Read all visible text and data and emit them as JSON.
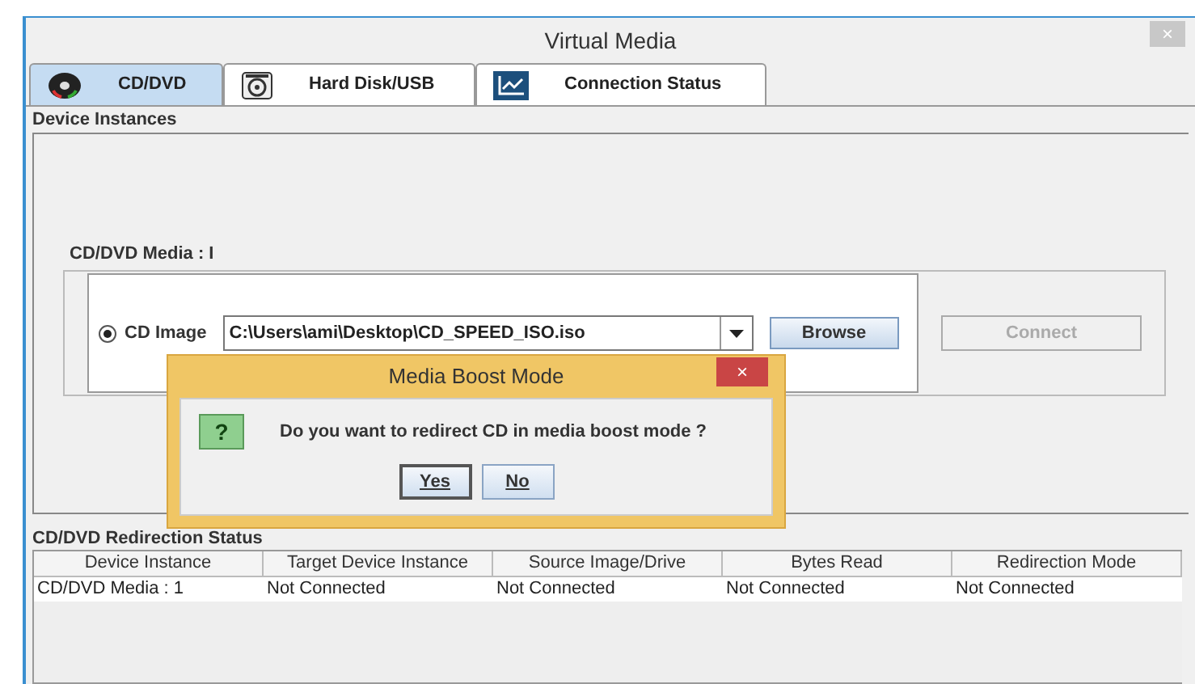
{
  "window": {
    "title": "Virtual Media",
    "close": "×"
  },
  "tabs": [
    {
      "label": "CD/DVD",
      "selected": true,
      "kind": "disc"
    },
    {
      "label": "Hard Disk/USB",
      "selected": false,
      "kind": "drive"
    },
    {
      "label": "Connection Status",
      "selected": false,
      "kind": "chart"
    }
  ],
  "device_instances": {
    "title": "Device Instances",
    "media_title": "CD/DVD Media : I",
    "option": {
      "label": "CD Image",
      "selected": true
    },
    "path": "C:\\Users\\ami\\Desktop\\CD_SPEED_ISO.iso",
    "browse": "Browse",
    "connect": {
      "label": "Connect",
      "disabled": true
    }
  },
  "dialog": {
    "title": "Media Boost Mode",
    "close": "×",
    "icon": "?",
    "message": "Do you want to redirect CD in media boost mode ?",
    "buttons": [
      {
        "label": "Yes",
        "focused": true
      },
      {
        "label": "No",
        "focused": false
      }
    ]
  },
  "redirection_status": {
    "title": "CD/DVD Redirection Status",
    "columns": [
      "Device Instance",
      "Target Device Instance",
      "Source Image/Drive",
      "Bytes Read",
      "Redirection Mode"
    ],
    "rows": [
      [
        "CD/DVD Media :  1",
        "Not Connected",
        "Not Connected",
        "Not Connected",
        "Not Connected"
      ]
    ]
  }
}
